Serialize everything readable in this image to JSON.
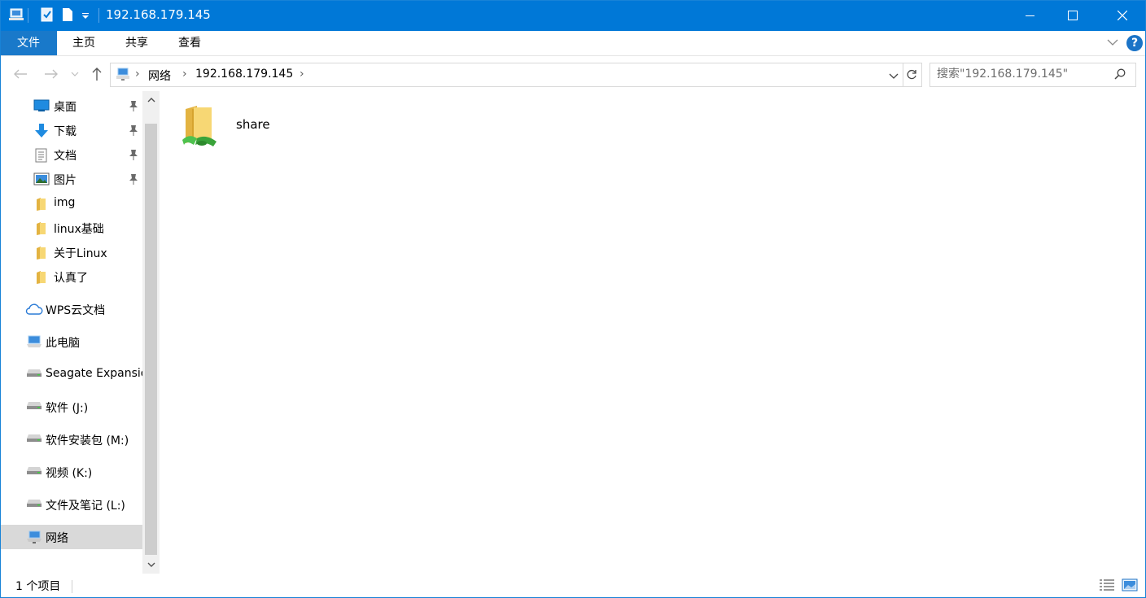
{
  "window": {
    "title": "192.168.179.145",
    "quick_access_icons": [
      "computer-icon",
      "properties-icon",
      "new-folder-icon",
      "dropdown-icon"
    ],
    "controls": [
      "minimize-icon",
      "maximize-icon",
      "close-icon"
    ]
  },
  "ribbon": {
    "tabs": [
      "文件",
      "主页",
      "共享",
      "查看"
    ],
    "active_tab": "文件",
    "help_label": "?"
  },
  "address_bar": {
    "breadcrumbs": [
      "网络",
      "192.168.179.145"
    ],
    "search_placeholder": "搜索\"192.168.179.145\""
  },
  "navigation": {
    "quick_access": [
      {
        "label": "桌面",
        "icon": "desktop-icon",
        "pinned": true
      },
      {
        "label": "下载",
        "icon": "download-icon",
        "pinned": true
      },
      {
        "label": "文档",
        "icon": "document-icon",
        "pinned": true
      },
      {
        "label": "图片",
        "icon": "picture-icon",
        "pinned": true
      },
      {
        "label": "img",
        "icon": "folder-icon",
        "pinned": false
      },
      {
        "label": "linux基础",
        "icon": "folder-icon",
        "pinned": false
      },
      {
        "label": "关于Linux",
        "icon": "folder-icon",
        "pinned": false
      },
      {
        "label": "认真了",
        "icon": "folder-icon",
        "pinned": false
      }
    ],
    "roots": [
      {
        "label": "WPS云文档",
        "icon": "cloud-icon"
      },
      {
        "label": "此电脑",
        "icon": "this-pc-icon"
      },
      {
        "label": "Seagate Expansion Drive",
        "icon": "drive-icon"
      },
      {
        "label": "软件 (J:)",
        "icon": "drive-icon"
      },
      {
        "label": "软件安装包 (M:)",
        "icon": "drive-icon"
      },
      {
        "label": "视频 (K:)",
        "icon": "drive-icon"
      },
      {
        "label": "文件及笔记 (L:)",
        "icon": "drive-icon"
      },
      {
        "label": "网络",
        "icon": "network-icon",
        "selected": true
      }
    ]
  },
  "content": {
    "items": [
      {
        "label": "share",
        "icon": "shared-folder-icon"
      }
    ]
  },
  "status_bar": {
    "item_count": "1 个项目"
  },
  "colors": {
    "titlebar": "#0078d7",
    "file_tab": "#1979ca",
    "selected_nav": "#d9d9d9",
    "folder_yellow": "#f7d774"
  }
}
